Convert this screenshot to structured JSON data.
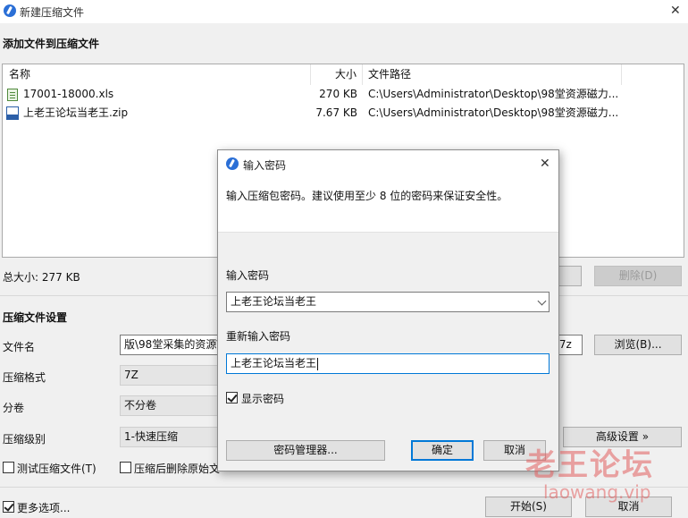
{
  "window": {
    "title": "新建压缩文件",
    "close_glyph": "✕"
  },
  "files_section": {
    "heading": "添加文件到压缩文件",
    "columns": [
      "名称",
      "大小",
      "文件路径"
    ],
    "rows": [
      {
        "name": "17001-18000.xls",
        "size": "270 KB",
        "path": "C:\\Users\\Administrator\\Desktop\\98堂资源磁力...",
        "icon": "excel-file-icon"
      },
      {
        "name": "上老王论坛当老王.zip",
        "size": "7.67 KB",
        "path": "C:\\Users\\Administrator\\Desktop\\98堂资源磁力...",
        "icon": "zip-file-icon"
      }
    ],
    "total_size": "总大小: 277 KB",
    "delete_label": "删除(D)"
  },
  "settings": {
    "heading": "压缩文件设置",
    "filename_label": "文件名",
    "filename_value": "版\\98堂采集的资源\\",
    "filename_suffix": ".7z",
    "browse_label": "浏览(B)...",
    "format_label": "压缩格式",
    "format_value": "7Z",
    "split_label": "分卷",
    "split_value": "不分卷",
    "level_label": "压缩级别",
    "level_value": "1-快速压缩",
    "advanced_label": "高级设置 »",
    "test_label": "测试压缩文件(T)",
    "delete_after_label": "压缩后删除原始文"
  },
  "footer": {
    "more_options": "更多选项...",
    "start": "开始(S)",
    "cancel": "取消"
  },
  "dialog": {
    "title": "输入密码",
    "close_glyph": "✕",
    "hint": "输入压缩包密码。建议使用至少 8 位的密码来保证安全性。",
    "password_label": "输入密码",
    "password_value": "上老王论坛当老王",
    "confirm_label": "重新输入密码",
    "confirm_value": "上老王论坛当老王",
    "show_password": "显示密码",
    "manager": "密码管理器...",
    "ok": "确定",
    "cancel": "取消"
  },
  "watermark": {
    "title": "老王论坛",
    "url": "laowang.vip"
  },
  "colors": {
    "accent": "#0078d7",
    "app_icon": "#2b6fd6",
    "watermark": "#e25f5f"
  }
}
